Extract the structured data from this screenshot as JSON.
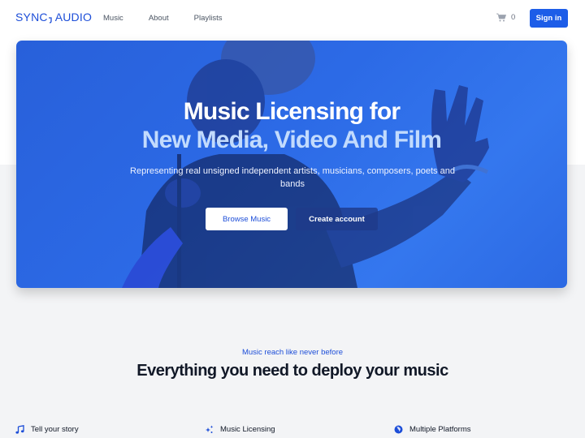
{
  "header": {
    "logo_left": "SYNC",
    "logo_right": "AUDIO",
    "nav": [
      {
        "label": "Music"
      },
      {
        "label": "About"
      },
      {
        "label": "Playlists"
      }
    ],
    "cart_count": "0",
    "signin_label": "Sign in"
  },
  "hero": {
    "title_line1": "Music Licensing for",
    "title_line2": "New Media, Video And Film",
    "subtitle": "Representing real unsigned independent artists, musicians, composers, poets and bands",
    "browse_label": "Browse Music",
    "create_label": "Create account"
  },
  "features_section": {
    "eyebrow": "Music reach like never before",
    "title": "Everything you need to deploy your music",
    "items": [
      {
        "icon": "music-note-icon",
        "label": "Tell your story"
      },
      {
        "icon": "sparkles-icon",
        "label": "Music Licensing"
      },
      {
        "icon": "globe-icon",
        "label": "Multiple Platforms"
      }
    ]
  },
  "colors": {
    "brand": "#1d4ed8",
    "signin_bg": "#1d5de8",
    "hero_bg": "#2c6ae6",
    "hero_title_accent": "#c2dbfd",
    "page_bg": "#f3f4f6"
  }
}
